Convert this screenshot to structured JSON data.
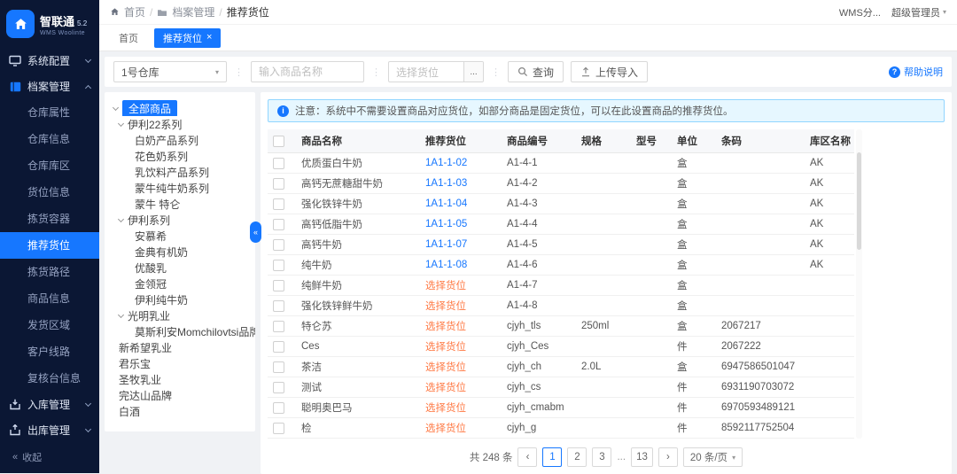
{
  "colors": {
    "accent": "#1677ff",
    "warning_orange": "#ff7a45",
    "sidebar_bg": "#0b1734",
    "notice_bg": "#e6f7ff",
    "notice_border": "#91d5ff"
  },
  "app": {
    "name": "智联通",
    "version": "5.2",
    "subtitle": "WMS Woolinte"
  },
  "topbar": {
    "breadcrumb": [
      {
        "label": "首页",
        "icon": "home-icon"
      },
      {
        "label": "档案管理",
        "icon": "folder-icon"
      },
      {
        "label": "推荐货位"
      }
    ],
    "user_org": "WMS分...",
    "user_role": "超级管理员"
  },
  "tabs": [
    {
      "label": "首页",
      "active": false,
      "closable": false
    },
    {
      "label": "推荐货位",
      "active": true,
      "closable": true
    }
  ],
  "sidebar": {
    "menu": [
      {
        "label": "系统配置",
        "icon": "monitor-icon",
        "expanded": false
      },
      {
        "label": "档案管理",
        "icon": "archive-icon",
        "expanded": true
      },
      {
        "label": "入库管理",
        "icon": "inbound-icon",
        "expanded": false
      },
      {
        "label": "出库管理",
        "icon": "outbound-icon",
        "expanded": false
      }
    ],
    "archive_children": [
      "仓库属性",
      "仓库信息",
      "仓库库区",
      "货位信息",
      "拣货容器",
      "推荐货位",
      "拣货路径",
      "商品信息",
      "发货区域",
      "客户线路",
      "复核台信息"
    ],
    "active_child": "推荐货位",
    "collapse_label": "收起"
  },
  "filterbar": {
    "warehouse_value": "1号仓库",
    "product_placeholder": "输入商品名称",
    "location_placeholder": "选择货位",
    "location_more": "...",
    "search_label": "查询",
    "upload_label": "上传导入",
    "help_label": "帮助说明"
  },
  "tree": {
    "items": [
      {
        "label": "全部商品",
        "level": 0,
        "chevron": true,
        "active": true
      },
      {
        "label": "伊利22系列",
        "level": 1,
        "chevron": true
      },
      {
        "label": "白奶产品系列",
        "level": 2
      },
      {
        "label": "花色奶系列",
        "level": 2
      },
      {
        "label": "乳饮料产品系列",
        "level": 2
      },
      {
        "label": "蒙牛纯牛奶系列",
        "level": 2
      },
      {
        "label": "蒙牛 特仑",
        "level": 2
      },
      {
        "label": "伊利系列",
        "level": 1,
        "chevron": true
      },
      {
        "label": "安慕希",
        "level": 2
      },
      {
        "label": "金典有机奶",
        "level": 2
      },
      {
        "label": "优酸乳",
        "level": 2
      },
      {
        "label": "金领冠",
        "level": 2
      },
      {
        "label": "伊利纯牛奶",
        "level": 2
      },
      {
        "label": "光明乳业",
        "level": 1,
        "chevron": true
      },
      {
        "label": "莫斯利安Momchilovtsi品牌",
        "level": 2
      },
      {
        "label": "新希望乳业",
        "level": 1
      },
      {
        "label": "君乐宝",
        "level": 1
      },
      {
        "label": "圣牧乳业",
        "level": 1
      },
      {
        "label": "完达山品牌",
        "level": 1
      },
      {
        "label": "白酒",
        "level": 1
      }
    ]
  },
  "notice": {
    "text": "注意：系统中不需要设置商品对应货位，如部分商品是固定货位，可以在此设置商品的推荐货位。"
  },
  "table": {
    "columns": [
      "商品名称",
      "推荐货位",
      "商品编号",
      "规格",
      "型号",
      "单位",
      "条码",
      "库区名称"
    ],
    "rows": [
      {
        "name": "优质蛋白牛奶",
        "location": "1A1-1-02",
        "assigned": true,
        "code": "A1-4-1",
        "spec": "",
        "model": "",
        "unit": "盒",
        "barcode": "",
        "area": "AK"
      },
      {
        "name": "高钙无蔗糖甜牛奶",
        "location": "1A1-1-03",
        "assigned": true,
        "code": "A1-4-2",
        "spec": "",
        "model": "",
        "unit": "盒",
        "barcode": "",
        "area": "AK"
      },
      {
        "name": "强化铁锌牛奶",
        "location": "1A1-1-04",
        "assigned": true,
        "code": "A1-4-3",
        "spec": "",
        "model": "",
        "unit": "盒",
        "barcode": "",
        "area": "AK"
      },
      {
        "name": "高钙低脂牛奶",
        "location": "1A1-1-05",
        "assigned": true,
        "code": "A1-4-4",
        "spec": "",
        "model": "",
        "unit": "盒",
        "barcode": "",
        "area": "AK"
      },
      {
        "name": "高钙牛奶",
        "location": "1A1-1-07",
        "assigned": true,
        "code": "A1-4-5",
        "spec": "",
        "model": "",
        "unit": "盒",
        "barcode": "",
        "area": "AK"
      },
      {
        "name": "纯牛奶",
        "location": "1A1-1-08",
        "assigned": true,
        "code": "A1-4-6",
        "spec": "",
        "model": "",
        "unit": "盒",
        "barcode": "",
        "area": "AK"
      },
      {
        "name": "纯鲜牛奶",
        "location": "选择货位",
        "assigned": false,
        "code": "A1-4-7",
        "spec": "",
        "model": "",
        "unit": "盒",
        "barcode": "",
        "area": ""
      },
      {
        "name": "强化铁锌鲜牛奶",
        "location": "选择货位",
        "assigned": false,
        "code": "A1-4-8",
        "spec": "",
        "model": "",
        "unit": "盒",
        "barcode": "",
        "area": ""
      },
      {
        "name": "特仑苏",
        "location": "选择货位",
        "assigned": false,
        "code": "cjyh_tls",
        "spec": "250ml",
        "model": "",
        "unit": "盒",
        "barcode": "2067217",
        "area": ""
      },
      {
        "name": "Ces",
        "location": "选择货位",
        "assigned": false,
        "code": "cjyh_Ces",
        "spec": "",
        "model": "",
        "unit": "件",
        "barcode": "2067222",
        "area": ""
      },
      {
        "name": "茶洁",
        "location": "选择货位",
        "assigned": false,
        "code": "cjyh_ch",
        "spec": "2.0L",
        "model": "",
        "unit": "盒",
        "barcode": "6947586501047",
        "area": ""
      },
      {
        "name": "测试",
        "location": "选择货位",
        "assigned": false,
        "code": "cjyh_cs",
        "spec": "",
        "model": "",
        "unit": "件",
        "barcode": "6931190703072",
        "area": ""
      },
      {
        "name": "聪明奥巴马",
        "location": "选择货位",
        "assigned": false,
        "code": "cjyh_cmabm",
        "spec": "",
        "model": "",
        "unit": "件",
        "barcode": "6970593489121",
        "area": ""
      },
      {
        "name": "检",
        "location": "选择货位",
        "assigned": false,
        "code": "cjyh_g",
        "spec": "",
        "model": "",
        "unit": "件",
        "barcode": "8592117752504",
        "area": ""
      }
    ]
  },
  "pagination": {
    "total": "共 248 条",
    "pages": [
      "1",
      "2",
      "3",
      "...",
      "13"
    ],
    "current": "1",
    "page_size": "20 条/页"
  }
}
